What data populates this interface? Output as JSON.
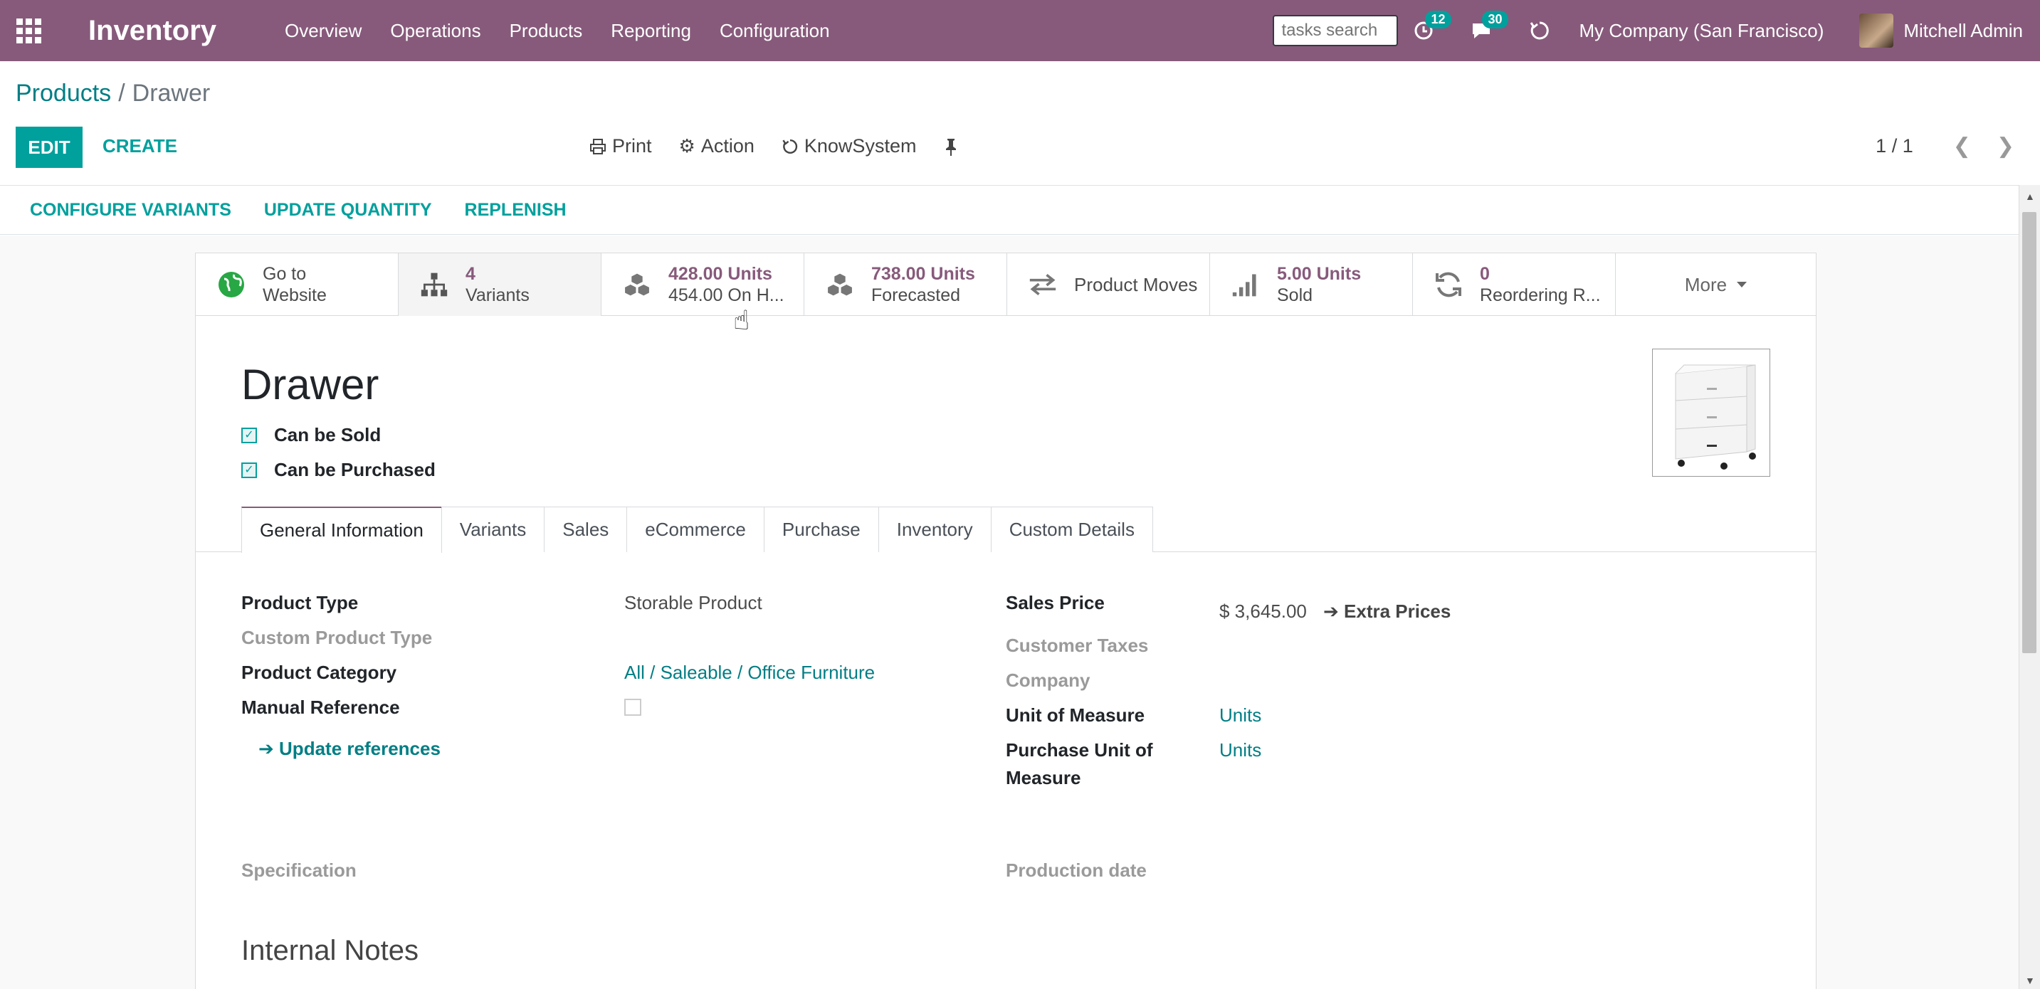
{
  "navbar": {
    "app_title": "Inventory",
    "menu": [
      "Overview",
      "Operations",
      "Products",
      "Reporting",
      "Configuration"
    ],
    "search_placeholder": "tasks search",
    "activity_count": "12",
    "messages_count": "30",
    "company": "My Company (San Francisco)",
    "user": "Mitchell Admin",
    "color": "#875a7b"
  },
  "breadcrumb": {
    "parent": "Products",
    "separator": "/",
    "current": "Drawer"
  },
  "toolbar": {
    "edit": "EDIT",
    "create": "CREATE",
    "print": "Print",
    "action": "Action",
    "knowsystem": "KnowSystem",
    "pager": "1 / 1"
  },
  "statusbar": {
    "buttons": [
      "CONFIGURE VARIANTS",
      "UPDATE QUANTITY",
      "REPLENISH"
    ]
  },
  "smart_buttons": {
    "website": {
      "line1": "Go to",
      "line2": "Website"
    },
    "variants": {
      "num": "4",
      "label": "Variants"
    },
    "on_hand": {
      "num": "428.00 Units",
      "label": "454.00 On H..."
    },
    "forecasted": {
      "num": "738.00 Units",
      "label": "Forecasted"
    },
    "moves": {
      "label": "Product Moves"
    },
    "sold": {
      "num": "5.00 Units",
      "label": "Sold"
    },
    "reordering": {
      "num": "0",
      "label": "Reordering R..."
    },
    "more": "More"
  },
  "product": {
    "name": "Drawer",
    "can_be_sold": "Can be Sold",
    "can_be_purchased": "Can be Purchased"
  },
  "tabs": [
    "General Information",
    "Variants",
    "Sales",
    "eCommerce",
    "Purchase",
    "Inventory",
    "Custom Details"
  ],
  "form": {
    "product_type_label": "Product Type",
    "product_type_value": "Storable Product",
    "custom_product_type_label": "Custom Product Type",
    "product_category_label": "Product Category",
    "product_category_value": "All / Saleable / Office Furniture",
    "manual_reference_label": "Manual Reference",
    "update_references": "Update references",
    "sales_price_label": "Sales Price",
    "sales_price_value": "$ 3,645.00",
    "extra_prices": "Extra Prices",
    "customer_taxes_label": "Customer Taxes",
    "company_label": "Company",
    "uom_label": "Unit of Measure",
    "uom_value": "Units",
    "purchase_uom_label_1": "Purchase Unit of",
    "purchase_uom_label_2": "Measure",
    "purchase_uom_value": "Units",
    "specification_label": "Specification",
    "production_date_label": "Production date",
    "internal_notes": "Internal Notes"
  }
}
